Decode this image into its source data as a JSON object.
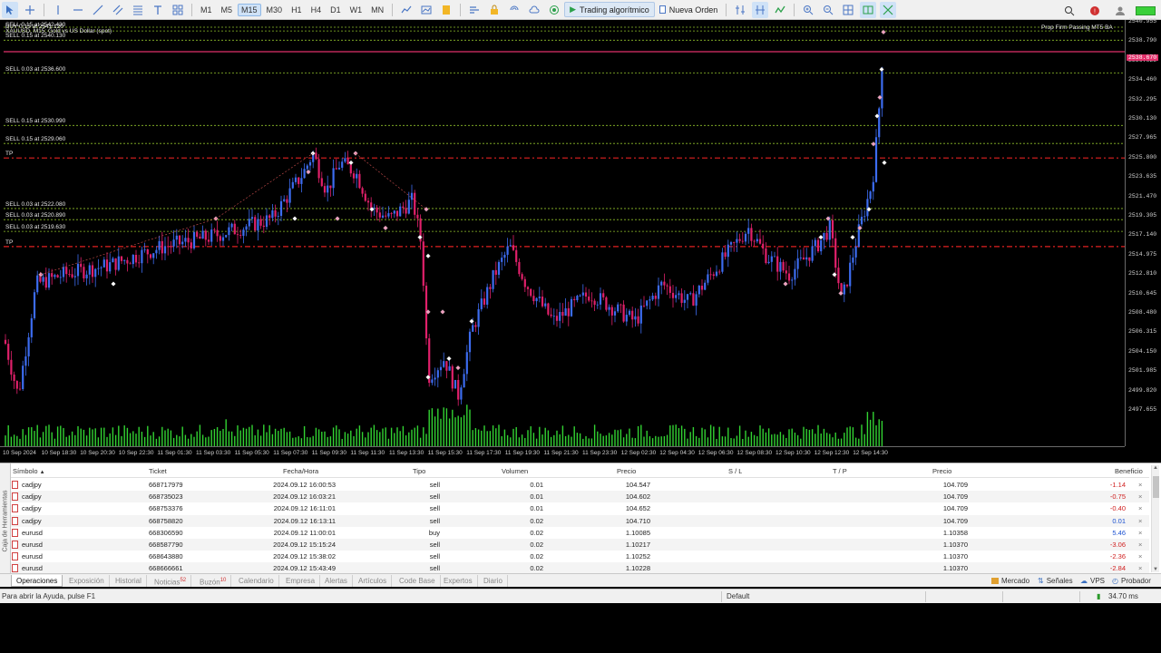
{
  "toolbar": {
    "timeframes": [
      "M1",
      "M5",
      "M15",
      "M30",
      "H1",
      "H4",
      "D1",
      "W1",
      "MN"
    ],
    "active_timeframe": "M15",
    "algo_trading_label": "Trading algorítmico",
    "new_order_label": "Nueva Orden"
  },
  "chart": {
    "symbol_line1": "XAUUSD, M15: Gold vs US Dollar (spot)",
    "symbol_line0": "SELL 0.15 at 2542.430",
    "ea_label": "Prop Firm Passing MT5 BA",
    "order_lines": [
      {
        "label": "BUY 0.15 at 2541.120",
        "price": 2541.12
      },
      {
        "label": "SELL 0.15 at 2540.130",
        "price": 2540.13
      },
      {
        "label": "SELL 0.03 at 2536.600",
        "price": 2536.6
      },
      {
        "label": "SELL 0.15 at 2530.990",
        "price": 2530.99
      },
      {
        "label": "SELL 0.15 at 2529.060",
        "price": 2529.06
      },
      {
        "label": "SELL 0.03 at 2522.080",
        "price": 2522.08
      },
      {
        "label": "SELL 0.03 at 2520.890",
        "price": 2520.89
      },
      {
        "label": "SELL 0.03 at 2519.630",
        "price": 2519.63
      }
    ],
    "tp_lines": [
      {
        "label": "TP",
        "price": 2527.5
      },
      {
        "label": "TP",
        "price": 2518.0
      }
    ],
    "price_ticks": [
      "2540.955",
      "2538.790",
      "2536.625",
      "2534.460",
      "2532.295",
      "2530.130",
      "2527.965",
      "2525.800",
      "2523.635",
      "2521.470",
      "2519.305",
      "2517.140",
      "2514.975",
      "2512.810",
      "2510.645",
      "2508.480",
      "2506.315",
      "2504.150",
      "2501.985",
      "2499.820",
      "2497.655"
    ],
    "current_price": "2538.670",
    "time_ticks": [
      "10 Sep 2024",
      "10 Sep 18:30",
      "10 Sep 20:30",
      "10 Sep 22:30",
      "11 Sep 01:30",
      "11 Sep 03:30",
      "11 Sep 05:30",
      "11 Sep 07:30",
      "11 Sep 09:30",
      "11 Sep 11:30",
      "11 Sep 13:30",
      "11 Sep 15:30",
      "11 Sep 17:30",
      "11 Sep 19:30",
      "11 Sep 21:30",
      "11 Sep 23:30",
      "12 Sep 02:30",
      "12 Sep 04:30",
      "12 Sep 06:30",
      "12 Sep 08:30",
      "12 Sep 10:30",
      "12 Sep 12:30",
      "12 Sep 14:30"
    ],
    "colors": {
      "bull": "#3c6cf0",
      "bear": "#e0206a",
      "volume": "#32d232",
      "order_line": "#8fbf2a",
      "tp_line": "#e02020"
    }
  },
  "trade_panel": {
    "side_label": "Caja de Herramientas",
    "headers": {
      "symbol": "Símbolo",
      "ticket": "Ticket",
      "time": "Fecha/Hora",
      "type": "Tipo",
      "volume": "Volumen",
      "price": "Precio",
      "sl": "S / L",
      "tp": "T / P",
      "current": "Precio",
      "profit": "Beneficio"
    },
    "rows": [
      {
        "symbol": "cadjpy",
        "ticket": "668717979",
        "time": "2024.09.12 16:00:53",
        "type": "sell",
        "volume": "0.01",
        "price": "104.547",
        "current": "104.709",
        "profit": "-1.14"
      },
      {
        "symbol": "cadjpy",
        "ticket": "668735023",
        "time": "2024.09.12 16:03:21",
        "type": "sell",
        "volume": "0.01",
        "price": "104.602",
        "current": "104.709",
        "profit": "-0.75"
      },
      {
        "symbol": "cadjpy",
        "ticket": "668753376",
        "time": "2024.09.12 16:11:01",
        "type": "sell",
        "volume": "0.01",
        "price": "104.652",
        "current": "104.709",
        "profit": "-0.40"
      },
      {
        "symbol": "cadjpy",
        "ticket": "668758820",
        "time": "2024.09.12 16:13:11",
        "type": "sell",
        "volume": "0.02",
        "price": "104.710",
        "current": "104.709",
        "profit": "0.01"
      },
      {
        "symbol": "eurusd",
        "ticket": "668306590",
        "time": "2024.09.12 11:00:01",
        "type": "buy",
        "volume": "0.02",
        "price": "1.10085",
        "current": "1.10358",
        "profit": "5.46"
      },
      {
        "symbol": "eurusd",
        "ticket": "668587790",
        "time": "2024.09.12 15:15:24",
        "type": "sell",
        "volume": "0.02",
        "price": "1.10217",
        "current": "1.10370",
        "profit": "-3.06"
      },
      {
        "symbol": "eurusd",
        "ticket": "668643880",
        "time": "2024.09.12 15:38:02",
        "type": "sell",
        "volume": "0.02",
        "price": "1.10252",
        "current": "1.10370",
        "profit": "-2.36"
      },
      {
        "symbol": "eurusd",
        "ticket": "668666661",
        "time": "2024.09.12 15:43:49",
        "type": "sell",
        "volume": "0.02",
        "price": "1.10228",
        "current": "1.10370",
        "profit": "-2.84"
      }
    ],
    "colors": {
      "negative": "#d02020",
      "positive": "#1a50d0"
    }
  },
  "tabs": [
    {
      "label": "Operaciones",
      "badge": ""
    },
    {
      "label": "Exposición",
      "badge": ""
    },
    {
      "label": "Historial",
      "badge": ""
    },
    {
      "label": "Noticias",
      "badge": "52"
    },
    {
      "label": "Buzón",
      "badge": "10"
    },
    {
      "label": "Calendario",
      "badge": ""
    },
    {
      "label": "Empresa",
      "badge": ""
    },
    {
      "label": "Alertas",
      "badge": ""
    },
    {
      "label": "Artículos",
      "badge": ""
    },
    {
      "label": "Code Base",
      "badge": ""
    },
    {
      "label": "Expertos",
      "badge": ""
    },
    {
      "label": "Diario",
      "badge": ""
    }
  ],
  "right_tabs": {
    "market": "Mercado",
    "signals": "Señales",
    "vps": "VPS",
    "tester": "Probador"
  },
  "status": {
    "help": "Para abrir la Ayuda, pulse F1",
    "profile": "Default",
    "ping": "34.70 ms"
  }
}
